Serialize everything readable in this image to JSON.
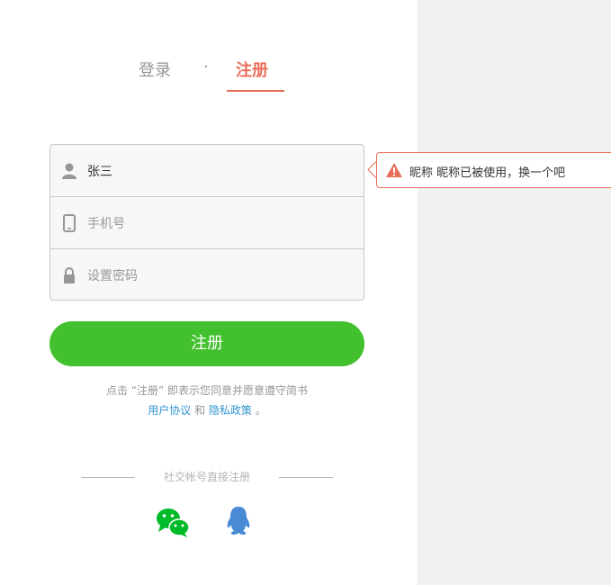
{
  "tabs": {
    "login": "登录",
    "separator": "·",
    "register": "注册"
  },
  "form": {
    "nickname_value": "张三",
    "phone_placeholder": "手机号",
    "password_placeholder": "设置密码"
  },
  "tooltip": {
    "message": "昵称 昵称已被使用，换一个吧"
  },
  "submit_label": "注册",
  "terms": {
    "prefix": "点击 “注册” 即表示您同意并愿意遵守简书",
    "user_agreement": "用户协议",
    "and": " 和 ",
    "privacy_policy": "隐私政策",
    "suffix": " 。"
  },
  "social": {
    "title": "社交帐号直接注册"
  },
  "colors": {
    "accent": "#ea6f5a",
    "submit": "#42c02e",
    "link": "#3194d0",
    "wechat": "#00bb29",
    "qq": "#498ad5"
  },
  "icons": [
    "user-icon",
    "phone-icon",
    "lock-icon",
    "warning-icon",
    "wechat-icon",
    "qq-icon"
  ]
}
